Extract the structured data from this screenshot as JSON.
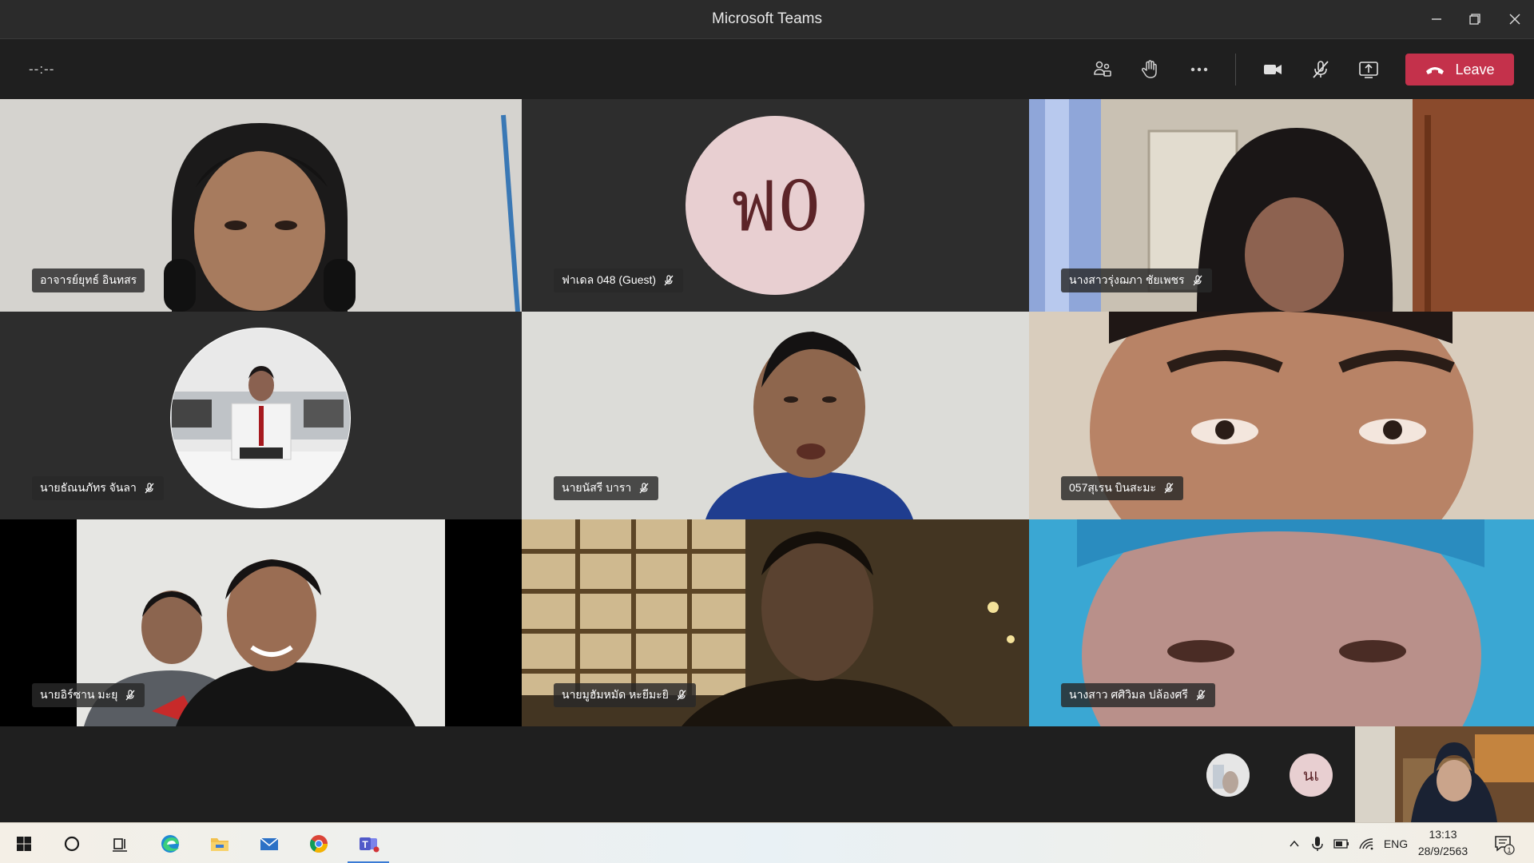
{
  "window": {
    "title": "Microsoft Teams"
  },
  "toolbar": {
    "timer": "--:--",
    "leave_label": "Leave"
  },
  "participants": [
    {
      "name": "อาจารย์ยุทธ์ อินทสร",
      "muted": false
    },
    {
      "name": "ฟาเดล 048 (Guest)",
      "muted": true,
      "initials": "ฟ0"
    },
    {
      "name": "นางสาวรุ่งฌภา ชัยเพชร",
      "muted": true
    },
    {
      "name": "นายธัณนภัทร จันลา",
      "muted": true
    },
    {
      "name": "นายนัสรี บารา",
      "muted": true
    },
    {
      "name": "057สุเรน บินสะมะ",
      "muted": true
    },
    {
      "name": "นายอิร์ซาน มะยุ",
      "muted": true
    },
    {
      "name": "นายมูฮัมหมัด หะยีมะยิ",
      "muted": true
    },
    {
      "name": "นางสาว ศศิวิมล ปล้องศรี",
      "muted": true
    }
  ],
  "overflow": {
    "initials": "นเ"
  },
  "taskbar": {
    "language": "ENG",
    "time": "13:13",
    "date": "28/9/2563",
    "notification_count": "1"
  },
  "colors": {
    "leave": "#c4314b",
    "avatar_bg": "#e8cfd1",
    "avatar_text": "#5c2428"
  }
}
